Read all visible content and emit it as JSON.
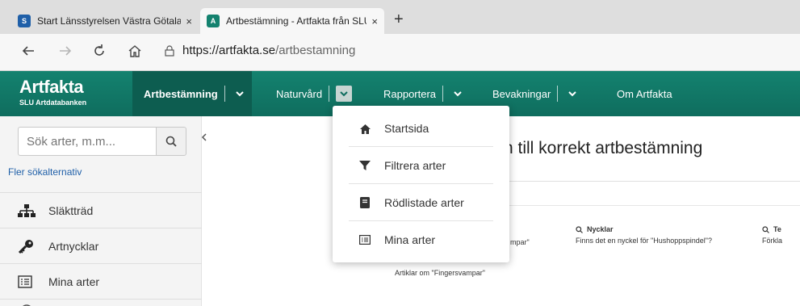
{
  "browser": {
    "tabs": [
      {
        "favicon": "S",
        "title": "Start Länsstyrelsen Västra Götala",
        "close": "×",
        "color": "#1f5fa8"
      },
      {
        "favicon": "A",
        "title": "Artbestämning - Artfakta från SLU",
        "close": "×",
        "color": "#14826f"
      }
    ],
    "new_tab": "+",
    "address": {
      "host": "https://artfakta.se",
      "path": "/artbestamning"
    }
  },
  "site": {
    "brand": "Artfakta",
    "sub": "SLU Artdatabanken",
    "accent": "#14826f",
    "nav": [
      {
        "label": "Artbestämning"
      },
      {
        "label": "Naturvård"
      },
      {
        "label": "Rapportera"
      },
      {
        "label": "Bevakningar"
      },
      {
        "label": "Om Artfakta"
      }
    ]
  },
  "dropdown": {
    "items": [
      {
        "label": "Startsida",
        "icon": "home-icon"
      },
      {
        "label": "Filtrera arter",
        "icon": "filter-icon"
      },
      {
        "label": "Rödlistade arter",
        "icon": "book-icon"
      },
      {
        "label": "Mina arter",
        "icon": "list-icon"
      }
    ]
  },
  "sidebar": {
    "search_placeholder": "Sök arter, m.m...",
    "more_search": "Fler sökalternativ",
    "items": [
      {
        "label": "Släktträd",
        "icon": "tree-icon"
      },
      {
        "label": "Artnycklar",
        "icon": "key-icon"
      },
      {
        "label": "Mina arter",
        "icon": "list-icon"
      }
    ]
  },
  "main": {
    "title": "n till korrekt artbestämning",
    "hints": [
      {
        "title": "",
        "desc": "mpar\""
      },
      {
        "title": "Nycklar",
        "desc": "Finns det en nyckel för \"Hushoppspindel\"?"
      },
      {
        "title": "Te",
        "desc": "Förkla"
      },
      {
        "title": "",
        "desc": "Artiklar om \"Fingersvampar\""
      }
    ]
  }
}
